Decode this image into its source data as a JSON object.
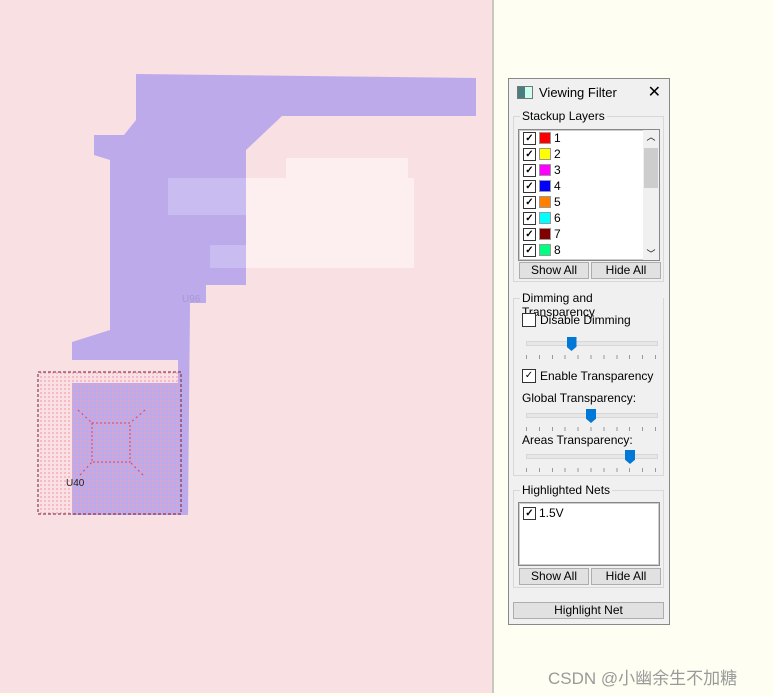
{
  "canvas": {
    "components": [
      {
        "ref": "U96"
      },
      {
        "ref": "U40"
      }
    ],
    "net_color": "#b9a9ea"
  },
  "panel": {
    "title": "Viewing Filter",
    "close_icon": "close-icon",
    "stackup": {
      "label": "Stackup Layers",
      "layers": [
        {
          "name": "1",
          "color": "#ff0000",
          "checked": true
        },
        {
          "name": "2",
          "color": "#ffff00",
          "checked": true
        },
        {
          "name": "3",
          "color": "#ff00ff",
          "checked": true
        },
        {
          "name": "4",
          "color": "#0000ff",
          "checked": true
        },
        {
          "name": "5",
          "color": "#ff8000",
          "checked": true
        },
        {
          "name": "6",
          "color": "#00ffff",
          "checked": true
        },
        {
          "name": "7",
          "color": "#800000",
          "checked": true
        },
        {
          "name": "8",
          "color": "#00ff80",
          "checked": true
        }
      ],
      "show_all": "Show All",
      "hide_all": "Hide All"
    },
    "dimming": {
      "label": "Dimming and Transparency",
      "disable_dimming": "Disable Dimming",
      "disable_dimming_checked": false,
      "dimming_level": 0.35,
      "enable_transparency": "Enable Transparency",
      "enable_transparency_checked": true,
      "global_label": "Global Transparency:",
      "global_level": 0.5,
      "areas_label": "Areas Transparency:",
      "areas_level": 0.8
    },
    "nets": {
      "label": "Highlighted Nets",
      "items": [
        {
          "name": "1.5V",
          "checked": true
        }
      ],
      "show_all": "Show All",
      "hide_all": "Hide All"
    },
    "highlight_net": "Highlight Net"
  },
  "watermark": "CSDN @小幽余生不加糖"
}
